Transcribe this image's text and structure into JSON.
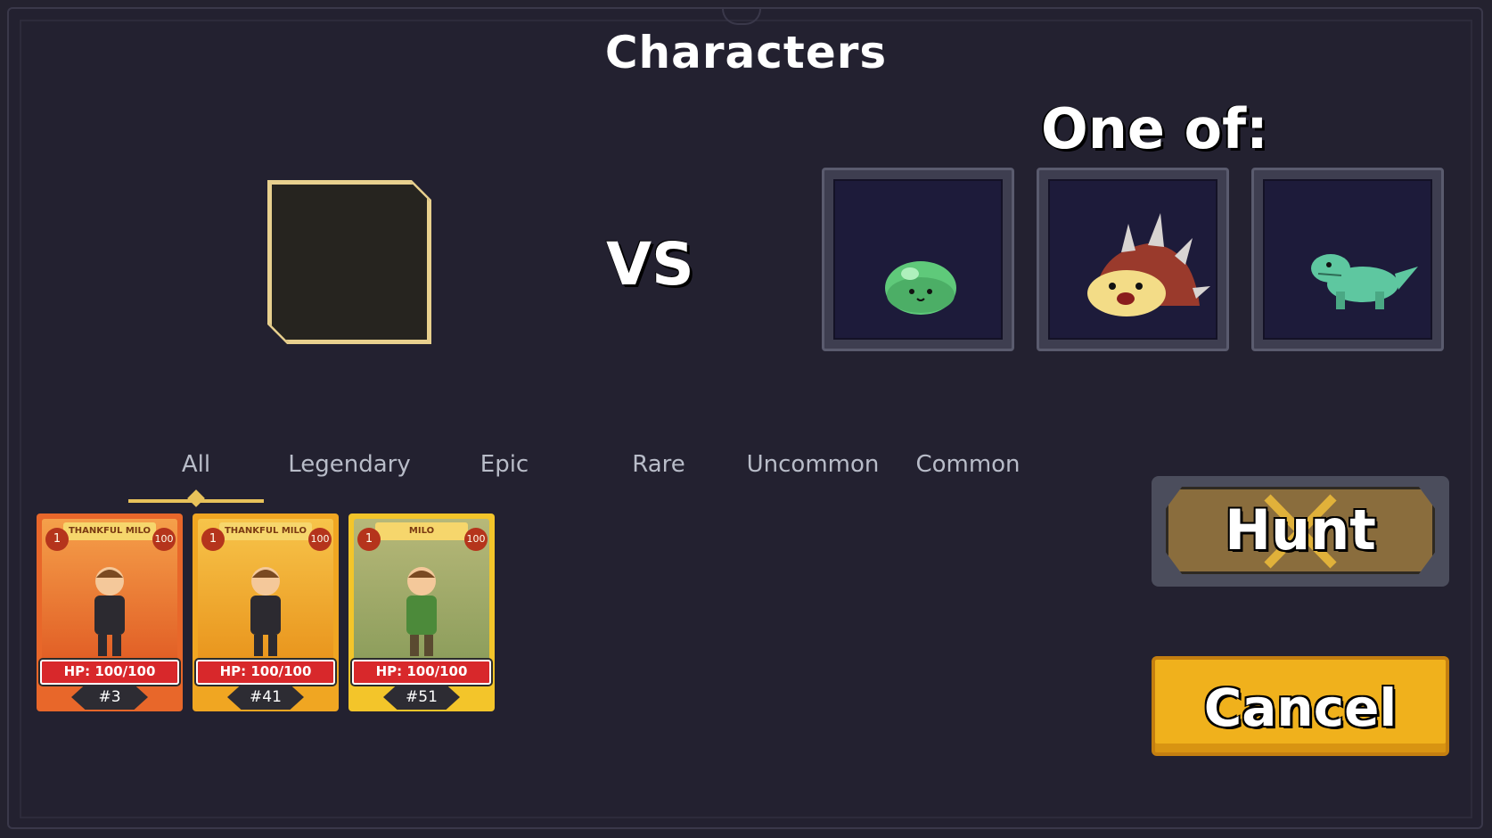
{
  "dialog": {
    "title": "Characters",
    "vs_label": "VS",
    "one_of_label": "One of:"
  },
  "enemies": [
    {
      "name": "green-slime"
    },
    {
      "name": "spiked-shell-creature"
    },
    {
      "name": "green-lizard"
    }
  ],
  "tabs": [
    {
      "label": "All",
      "selected": true
    },
    {
      "label": "Legendary",
      "selected": false
    },
    {
      "label": "Epic",
      "selected": false
    },
    {
      "label": "Rare",
      "selected": false
    },
    {
      "label": "Uncommon",
      "selected": false
    },
    {
      "label": "Common",
      "selected": false
    }
  ],
  "cards": [
    {
      "banner": "THANKFUL MILO",
      "level": "1",
      "hp_badge": "100",
      "hp_text": "HP: 100/100",
      "number": "#3",
      "color": "#e8672a"
    },
    {
      "banner": "THANKFUL MILO",
      "level": "1",
      "hp_badge": "100",
      "hp_text": "HP: 100/100",
      "number": "#41",
      "color": "#f0a622"
    },
    {
      "banner": "MILO",
      "level": "1",
      "hp_badge": "100",
      "hp_text": "HP: 100/100",
      "number": "#51",
      "color": "#f3c52a"
    }
  ],
  "actions": {
    "hunt_label": "Hunt",
    "cancel_label": "Cancel"
  }
}
